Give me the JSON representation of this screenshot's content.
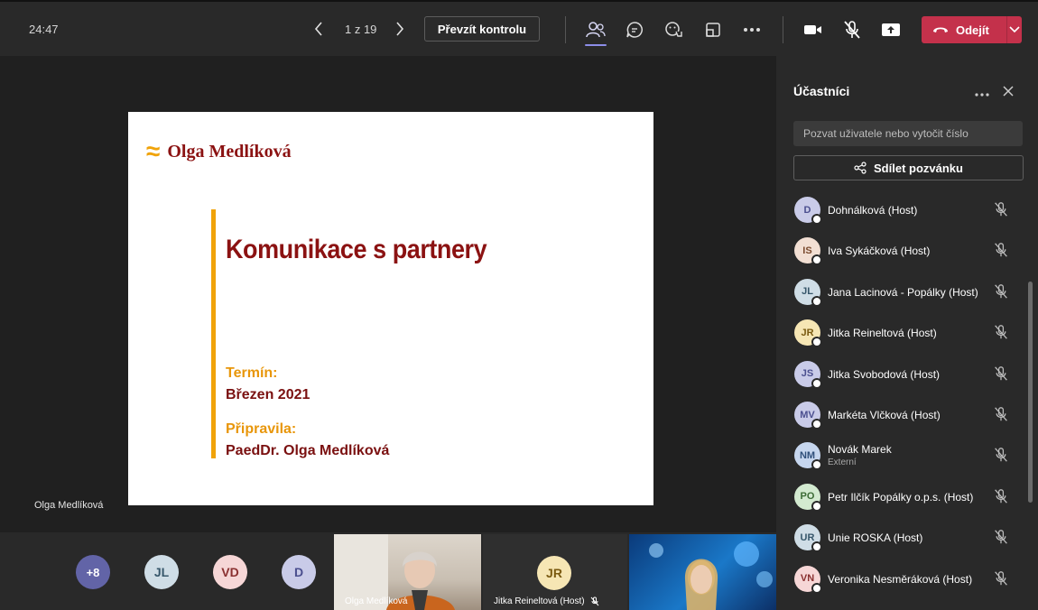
{
  "topbar": {
    "timer": "24:47",
    "page_indicator": "1 z 19",
    "take_control": "Převzít kontrolu",
    "leave_label": "Odejít"
  },
  "slide": {
    "logo_mark": "≈",
    "logo_text": "Olga Medlíková",
    "title": "Komunikace s partnery",
    "term_label": "Termín:",
    "term_value": "Březen 2021",
    "prepared_label": "Připravila:",
    "prepared_value": "PaedDr. Olga Medlíková"
  },
  "presenter_name": "Olga Medlíková",
  "strip": {
    "more_count": "+8",
    "avatars": [
      "JL",
      "VD",
      "D"
    ],
    "tiles": [
      {
        "label": "Olga Medlíková"
      },
      {
        "initials": "JR",
        "label": "Jitka Reineltová (Host)"
      },
      {
        "label": ""
      }
    ]
  },
  "panel": {
    "title": "Účastníci",
    "invite_placeholder": "Pozvat uživatele nebo vytočit číslo",
    "share_label": "Sdílet pozvánku",
    "participants": [
      {
        "initials": "D",
        "name": "Dohnálková (Host)",
        "color": "#c9cbe8",
        "text": "#4b4f8f"
      },
      {
        "initials": "IS",
        "name": "Iva Sykáčková (Host)",
        "color": "#f2dfd3",
        "text": "#7a4a2e"
      },
      {
        "initials": "JL",
        "name": "Jana Lacinová - Popálky (Host)",
        "color": "#cfdde6",
        "text": "#37576b"
      },
      {
        "initials": "JR",
        "name": "Jitka Reineltová (Host)",
        "color": "#f6e6b4",
        "text": "#7a5a10"
      },
      {
        "initials": "JS",
        "name": "Jitka Svobodová (Host)",
        "color": "#c9cbe8",
        "text": "#4b4f8f"
      },
      {
        "initials": "MV",
        "name": "Markéta Vlčková (Host)",
        "color": "#c9cbe8",
        "text": "#4b4f8f"
      },
      {
        "initials": "NM",
        "name": "Novák Marek",
        "sub": "Externí",
        "color": "#c6d6ee",
        "text": "#2f4f7a"
      },
      {
        "initials": "PO",
        "name": "Petr Ilčík Popálky o.p.s. (Host)",
        "color": "#d3ead0",
        "text": "#3c6b35"
      },
      {
        "initials": "UR",
        "name": "Unie ROSKA (Host)",
        "color": "#cfdde6",
        "text": "#37576b"
      },
      {
        "initials": "VN",
        "name": "Veronika Nesměráková (Host)",
        "color": "#f6d6d6",
        "text": "#8a3030"
      }
    ]
  },
  "colors": {
    "leave": "#c4314b",
    "accent": "#8c8de8",
    "brand_red": "#8b1212",
    "brand_orange": "#f0a30a"
  }
}
